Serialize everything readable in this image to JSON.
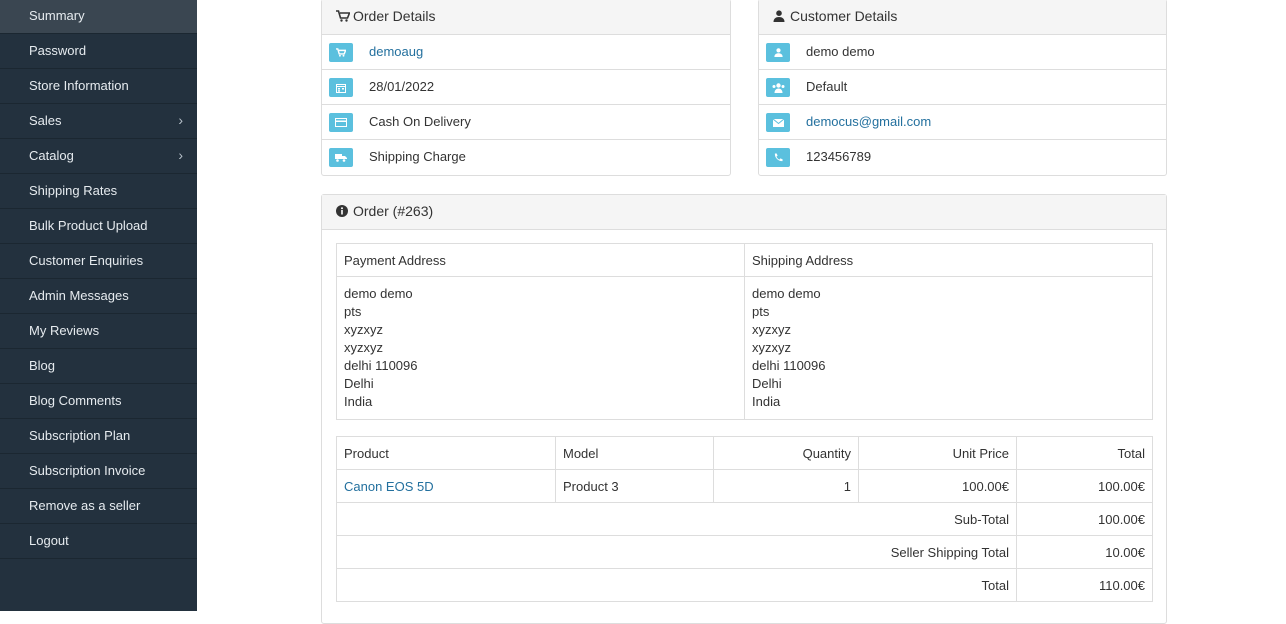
{
  "sidebar": {
    "items": [
      {
        "label": "Summary",
        "active": true
      },
      {
        "label": "Password"
      },
      {
        "label": "Store Information"
      },
      {
        "label": "Sales",
        "chevron": true
      },
      {
        "label": "Catalog",
        "chevron": true
      },
      {
        "label": "Shipping Rates"
      },
      {
        "label": "Bulk Product Upload"
      },
      {
        "label": "Customer Enquiries"
      },
      {
        "label": "Admin Messages"
      },
      {
        "label": "My Reviews"
      },
      {
        "label": "Blog"
      },
      {
        "label": "Blog Comments"
      },
      {
        "label": "Subscription Plan"
      },
      {
        "label": "Subscription Invoice"
      },
      {
        "label": "Remove as a seller"
      },
      {
        "label": "Logout"
      }
    ]
  },
  "order_details": {
    "title": "Order Details",
    "store": "demoaug",
    "date": "28/01/2022",
    "payment_method": "Cash On Delivery",
    "shipping_method": "Shipping Charge"
  },
  "customer_details": {
    "title": "Customer Details",
    "name": "demo demo",
    "group": "Default",
    "email": "democus@gmail.com",
    "phone": "123456789"
  },
  "order": {
    "title": "Order (#263)",
    "payment_address_header": "Payment Address",
    "shipping_address_header": "Shipping Address",
    "payment_address": [
      "demo demo",
      "pts",
      "xyzxyz",
      "xyzxyz",
      "delhi 110096",
      "Delhi",
      "India"
    ],
    "shipping_address": [
      "demo demo",
      "pts",
      "xyzxyz",
      "xyzxyz",
      "delhi 110096",
      "Delhi",
      "India"
    ],
    "columns": {
      "product": "Product",
      "model": "Model",
      "quantity": "Quantity",
      "unit_price": "Unit Price",
      "total": "Total"
    },
    "line": {
      "product": "Canon EOS 5D",
      "model": "Product 3",
      "quantity": "1",
      "unit_price": "100.00€",
      "total": "100.00€"
    },
    "totals": [
      {
        "label": "Sub-Total",
        "value": "100.00€"
      },
      {
        "label": "Seller Shipping Total",
        "value": "10.00€"
      },
      {
        "label": "Total",
        "value": "110.00€"
      }
    ]
  },
  "colors": {
    "sidebar": "#23313e",
    "accent_badge": "#5bc0de",
    "link": "#23709e"
  }
}
